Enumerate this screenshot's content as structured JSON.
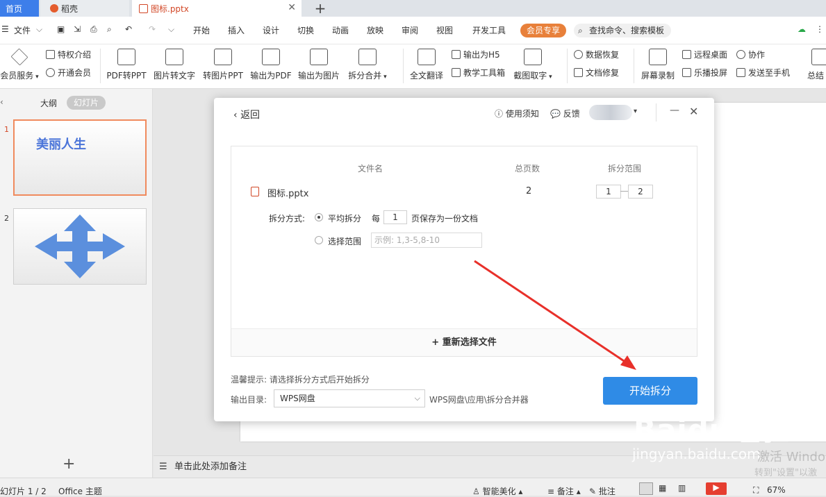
{
  "tabs": {
    "home": "首页",
    "daoke": "稻壳",
    "file": "图标.pptx"
  },
  "menu": {
    "file": "文件",
    "items": [
      "开始",
      "插入",
      "设计",
      "切换",
      "动画",
      "放映",
      "审阅",
      "视图",
      "开发工具"
    ],
    "vip": "会员专享",
    "search": "查找命令、搜索模板"
  },
  "ribbon": {
    "vip_service": "会员服务",
    "privilege": "特权介绍",
    "open_vip": "开通会员",
    "pdf2ppt": "PDF转PPT",
    "img2text": "图片转文字",
    "img2ppt": "转图片PPT",
    "export_pdf": "输出为PDF",
    "export_img": "输出为图片",
    "split_merge": "拆分合并",
    "translate": "全文翻译",
    "export_h5": "输出为H5",
    "teaching": "教学工具箱",
    "screenshot_text": "截图取字",
    "data_recovery": "数据恢复",
    "doc_repair": "文档修复",
    "screen_record": "屏幕录制",
    "remote_desktop": "远程桌面",
    "cast": "乐播投屏",
    "collab": "协作",
    "send_phone": "发送至手机",
    "summary": "总结"
  },
  "left": {
    "outline": "大纲",
    "slides": "幻灯片",
    "slide1_num": "1",
    "slide1_title": "美丽人生",
    "slide2_num": "2",
    "add": "+"
  },
  "notes": "单击此处添加备注",
  "status": {
    "slide": "幻灯片 1 / 2",
    "theme": "Office 主题",
    "beautify": "智能美化",
    "notes": "备注",
    "comments": "批注",
    "zoom": "67%"
  },
  "dialog": {
    "back": "返回",
    "usage": "使用须知",
    "feedback": "反馈",
    "min": "—",
    "close": "✕",
    "col_name": "文件名",
    "col_pages": "总页数",
    "col_range": "拆分范围",
    "file_name": "图标.pptx",
    "total_pages": "2",
    "range_from": "1",
    "range_to": "2",
    "split_method": "拆分方式:",
    "opt_even": "平均拆分",
    "every": "每",
    "every_value": "1",
    "every_suffix": "页保存为一份文档",
    "opt_range": "选择范围",
    "range_placeholder": "示例: 1,3-5,8-10",
    "reselect": "+ 重新选择文件",
    "tip": "温馨提示: 请选择拆分方式后开始拆分",
    "outdir_label": "输出目录:",
    "outdir_value": "WPS网盘",
    "outdir_path": "WPS网盘\\应用\\拆分合并器",
    "start": "开始拆分"
  },
  "watermark": {
    "baidu": "Baidu经验",
    "jingyan": "jingyan.baidu.com",
    "activate": "激活 Windo",
    "activate2": "转到\"设置\"以激"
  },
  "colors": {
    "accent": "#2f8be6",
    "vip": "#e8803a",
    "arrow": "#e8302a",
    "tab_active": "#3d7eea"
  }
}
